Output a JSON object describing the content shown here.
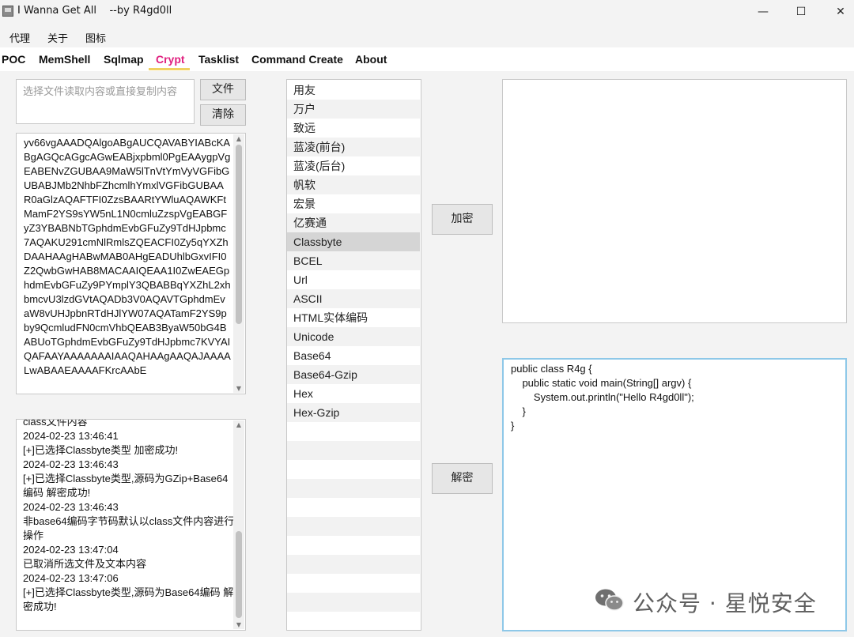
{
  "window": {
    "title": "I Wanna Get All    --by R4gd0ll",
    "minimize": "—",
    "maximize": "☐",
    "close": "✕"
  },
  "menu": [
    "代理",
    "关于",
    "图标"
  ],
  "tabs": [
    "POC",
    "MemShell",
    "Sqlmap",
    "Crypt",
    "Tasklist",
    "Command Create",
    "About"
  ],
  "active_tab": "Crypt",
  "input": {
    "placeholder": "选择文件读取内容或直接复制内容",
    "file_button": "文件",
    "clear_button": "清除"
  },
  "encoded_text": "yv66vgAAADQAlgoABgAUCQAVABYIABcKABgAGQcAGgcAGwEABjxpbml0PgEAAygpVgEABENvZGUBAA9MaW5lTnVtYmVyVGFibGUBABJMb2NhbFZhcmlhYmxlVGFibGUBAAR0aGlzAQAFTFI0ZzsBAARtYWluAQAWKFtMamF2YS9sYW5nL1N0cmluZzspVgEABGFyZ3YBABNbTGphdmEvbGFuZy9TdHJpbmc7AQAKU291cmNlRmlsZQEACFI0Zy5qYXZhDAAHAAgHABwMAB0AHgEADUhlbGxvIFI0Z2QwbGwHAB8MACAAIQEAA1I0ZwEAEGphdmEvbGFuZy9PYmplY3QBABBqYXZhL2xhbmcvU3lzdGVtAQADb3V0AQAVTGphdmEvaW8vUHJpbnRTdHJlYW07AQATamF2YS9pby9QcmludFN0cmVhbQEAB3ByaW50bG4BABUoTGphdmEvbGFuZy9TdHJpbmc7KVYAIQAFAAYAAAAAAAIAAQAHAAgAAQAJAAAALwABAAEAAAAFKrcAAbE",
  "log": [
    "class文件内容",
    "2024-02-23 13:46:41",
    "[+]已选择Classbyte类型 加密成功!",
    "2024-02-23 13:46:43",
    "[+]已选择Classbyte类型,源码为GZip+Base64编码 解密成功!",
    "2024-02-23 13:46:43",
    "非base64编码字节码默认以class文件内容进行操作",
    "2024-02-23 13:47:04",
    "已取消所选文件及文本内容",
    "2024-02-23 13:47:06",
    "[+]已选择Classbyte类型,源码为Base64编码 解密成功!"
  ],
  "crypt_types": [
    "用友",
    "万户",
    "致远",
    "蓝凌(前台)",
    "蓝凌(后台)",
    "帆软",
    "宏景",
    "亿赛通",
    "Classbyte",
    "BCEL",
    "Url",
    "ASCII",
    "HTML实体编码",
    "Unicode",
    "Base64",
    "Base64-Gzip",
    "Hex",
    "Hex-Gzip"
  ],
  "selected_type": "Classbyte",
  "buttons": {
    "encrypt": "加密",
    "decrypt": "解密"
  },
  "output_text": "",
  "source_code": "public class R4g {\n    public static void main(String[] argv) {\n        System.out.println(\"Hello R4gd0ll\");\n    }\n}",
  "watermark": "公众号 · 星悦安全",
  "colors": {
    "active_tab": "#e0207f",
    "focus_border": "#8ec8e8"
  }
}
